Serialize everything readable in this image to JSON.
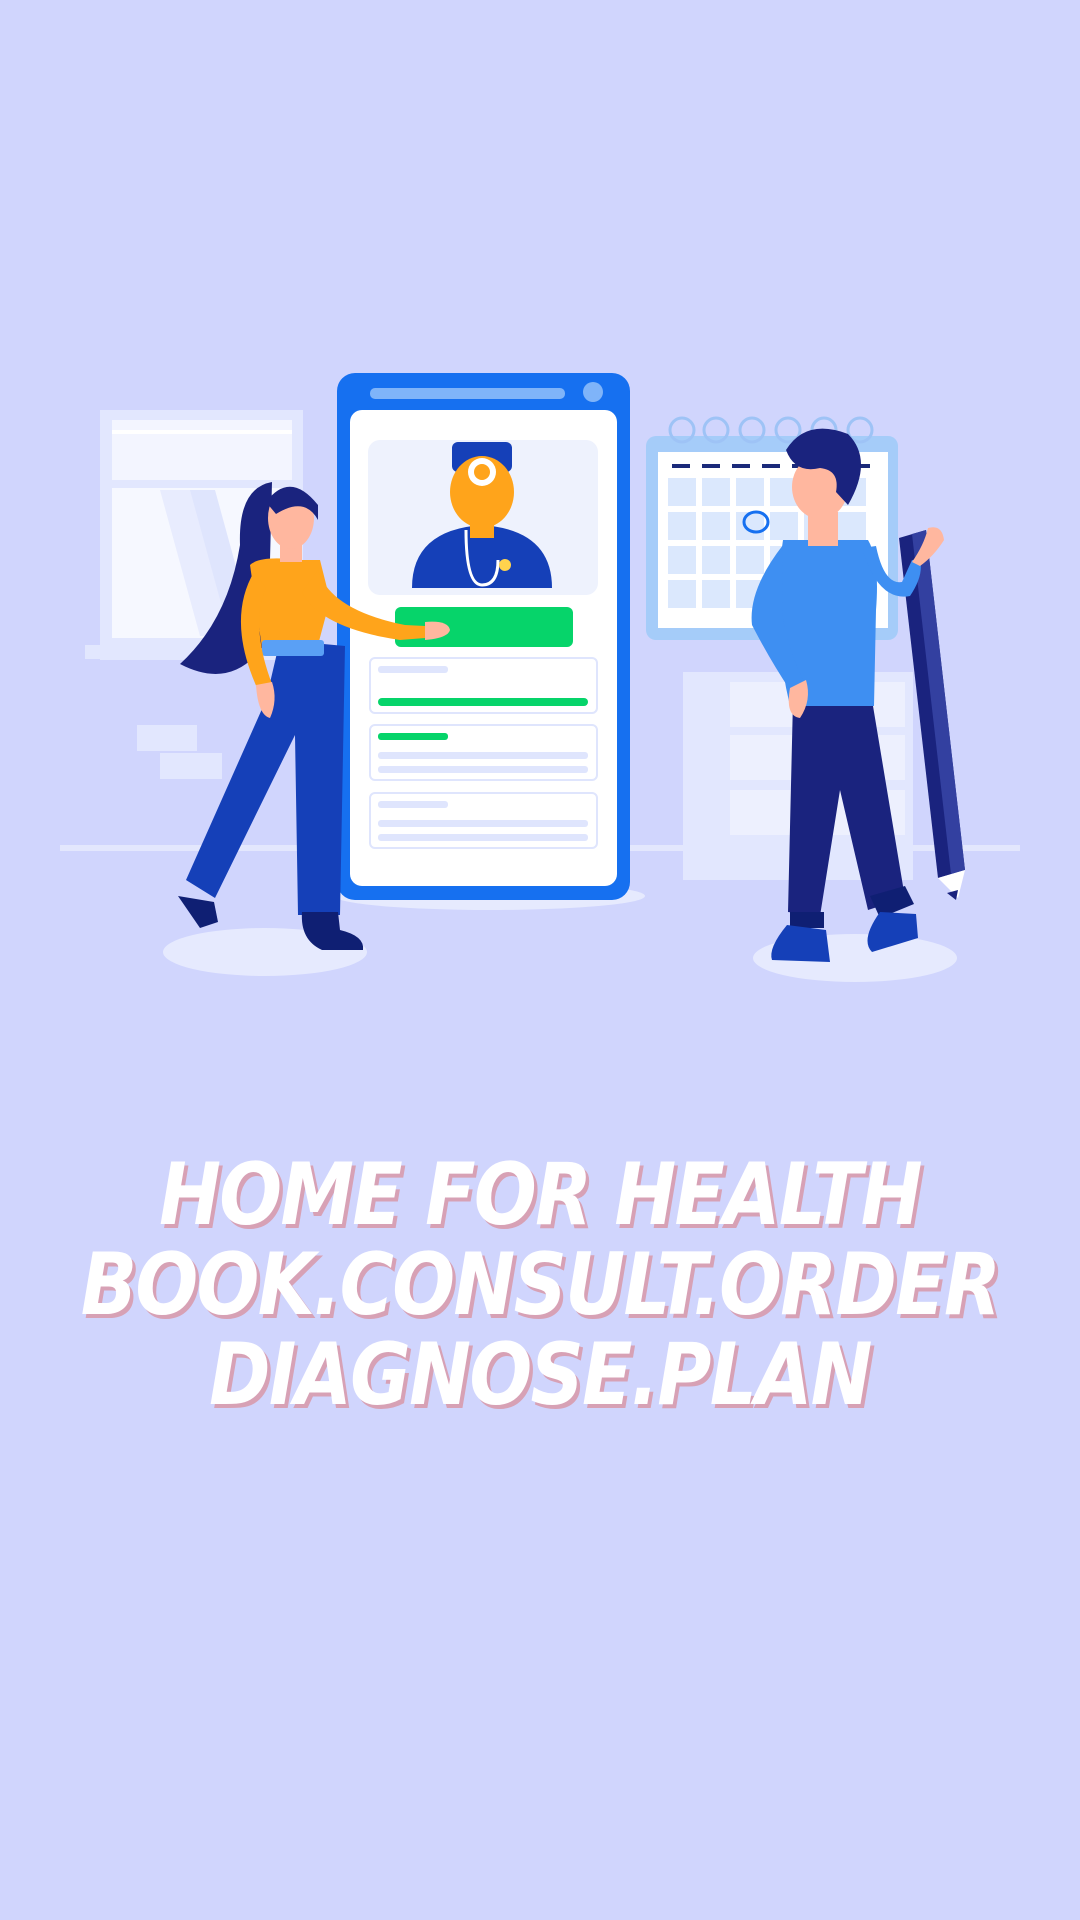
{
  "colors": {
    "background": "#d0d5fd",
    "text": "#ffffff",
    "text_shadow": "#d7a1b5",
    "phone_frame": "#1670f0",
    "primary_button": "#06d46a",
    "navy": "#0f1f73",
    "mid_blue": "#1540b8",
    "light_blue": "#3e8ff2",
    "orange": "#ffa41b"
  },
  "illustration": {
    "icons": [
      "doctor-avatar-icon",
      "stethoscope-icon",
      "calendar-icon",
      "pencil-icon"
    ]
  },
  "tagline": {
    "line1": "HOME FOR HEALTH",
    "line2": "BOOK.CONSULT.ORDER",
    "line3": "DIAGNOSE.PLAN"
  }
}
